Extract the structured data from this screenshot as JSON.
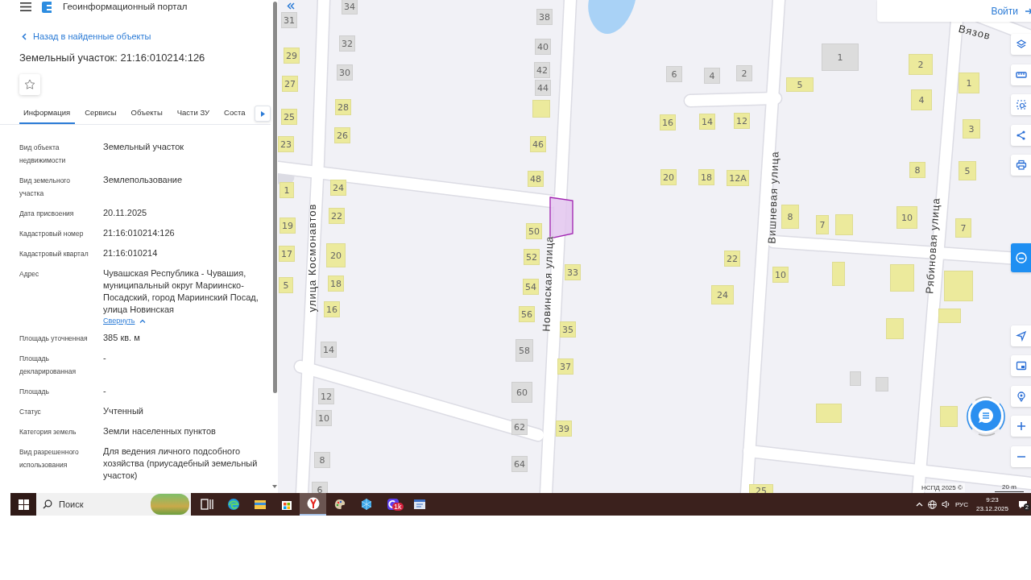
{
  "app_header": {
    "title": "Геоинформационный портал"
  },
  "back_link": "Назад в найденные объекты",
  "object_title": "Земельный участок: 21:16:010214:126",
  "favorite": {
    "on": false
  },
  "tabs": [
    {
      "label": "Информация",
      "selected": true
    },
    {
      "label": "Сервисы",
      "selected": false
    },
    {
      "label": "Объекты",
      "selected": false
    },
    {
      "label": "Части ЗУ",
      "selected": false
    },
    {
      "label": "Соста",
      "selected": false
    }
  ],
  "properties": [
    {
      "label": "Вид объекта недвижимости",
      "value": "Земельный участок"
    },
    {
      "label": "Вид земельного участка",
      "value": "Землепользование"
    },
    {
      "label": "Дата присвоения",
      "value": "20.11.2025"
    },
    {
      "label": "Кадастровый номер",
      "value": "21:16:010214:126"
    },
    {
      "label": "Кадастровый квартал",
      "value": "21:16:010214"
    },
    {
      "label": "Адрес",
      "value": "Чувашская Республика - Чувашия, муниципальный округ Мариинско-Посадский, город Мариинский Посад, улица Новинская",
      "link": "Свернуть"
    },
    {
      "label": "Площадь уточненная",
      "value": "385 кв. м"
    },
    {
      "label": "Площадь декларированная",
      "value": "-"
    },
    {
      "label": "Площадь",
      "value": "-"
    },
    {
      "label": "Статус",
      "value": "Учтенный"
    },
    {
      "label": "Категория земель",
      "value": "Земли населенных пунктов"
    },
    {
      "label": "Вид разрешенного использования",
      "value": "Для ведения личного подсобного хозяйства (приусадебный земельный участок)"
    }
  ],
  "map": {
    "buildings": [
      {
        "number": "31",
        "color": "#dcdcdc"
      },
      {
        "number": "29",
        "color": "#ecea9c"
      },
      {
        "number": "27",
        "color": "#ecea9c"
      },
      {
        "number": "25",
        "color": "#ecea9c"
      },
      {
        "number": "23",
        "color": "#ecea9c"
      },
      {
        "number": "1",
        "color": "#ecea9c"
      },
      {
        "number": "19",
        "color": "#ecea9c"
      },
      {
        "number": "17",
        "color": "#ecea9c"
      },
      {
        "number": "5",
        "color": "#ecea9c"
      },
      {
        "number": "34",
        "color": "#dcdcdc"
      },
      {
        "number": "32",
        "color": "#dcdcdc"
      },
      {
        "number": "30",
        "color": "#dcdcdc"
      },
      {
        "number": "28",
        "color": "#ecea9c"
      },
      {
        "number": "26",
        "color": "#ecea9c"
      },
      {
        "number": "24",
        "color": "#ecea9c"
      },
      {
        "number": "22",
        "color": "#ecea9c"
      },
      {
        "number": "20",
        "color": "#ecea9c"
      },
      {
        "number": "18",
        "color": "#ecea9c"
      },
      {
        "number": "16",
        "color": "#ecea9c"
      },
      {
        "number": "14",
        "color": "#dcdcdc"
      },
      {
        "number": "12",
        "color": "#dcdcdc"
      },
      {
        "number": "10",
        "color": "#dcdcdc"
      },
      {
        "number": "8",
        "color": "#dcdcdc"
      },
      {
        "number": "6",
        "color": "#dcdcdc"
      },
      {
        "number": "38",
        "color": "#dcdcdc"
      },
      {
        "number": "40",
        "color": "#dcdcdc"
      },
      {
        "number": "42",
        "color": "#dcdcdc"
      },
      {
        "number": "44",
        "color": "#dcdcdc"
      },
      {
        "number": "46",
        "color": "#ecea9c"
      },
      {
        "number": "48",
        "color": "#ecea9c"
      },
      {
        "number": "50",
        "color": "#ecea9c"
      },
      {
        "number": "52",
        "color": "#ecea9c"
      },
      {
        "number": "54",
        "color": "#ecea9c"
      },
      {
        "number": "56",
        "color": "#ecea9c"
      },
      {
        "number": "58",
        "color": "#dcdcdc"
      },
      {
        "number": "60",
        "color": "#dcdcdc"
      },
      {
        "number": "62",
        "color": "#dcdcdc"
      },
      {
        "number": "64",
        "color": "#dcdcdc"
      },
      {
        "number": "33",
        "color": "#ecea9c"
      },
      {
        "number": "35",
        "color": "#ecea9c"
      },
      {
        "number": "37",
        "color": "#ecea9c"
      },
      {
        "number": "39",
        "color": "#ecea9c"
      },
      {
        "number": "25",
        "color": "#ecea9c"
      },
      {
        "number": "6",
        "color": "#dcdcdc"
      },
      {
        "number": "4",
        "color": "#dcdcdc"
      },
      {
        "number": "2",
        "color": "#dcdcdc"
      },
      {
        "number": "1",
        "color": "#dcdcdc"
      },
      {
        "number": "2",
        "color": "#ecea9c"
      },
      {
        "number": "1",
        "color": "#ecea9c"
      },
      {
        "number": "4",
        "color": "#ecea9c"
      },
      {
        "number": "5",
        "color": "#ecea9c"
      },
      {
        "number": "16",
        "color": "#ecea9c"
      },
      {
        "number": "14",
        "color": "#ecea9c"
      },
      {
        "number": "12",
        "color": "#ecea9c"
      },
      {
        "number": "3",
        "color": "#ecea9c"
      },
      {
        "number": "8",
        "color": "#ecea9c"
      },
      {
        "number": "5",
        "color": "#ecea9c"
      },
      {
        "number": "20",
        "color": "#ecea9c"
      },
      {
        "number": "18",
        "color": "#ecea9c"
      },
      {
        "number": "12А",
        "color": "#ecea9c"
      },
      {
        "number": "8",
        "color": "#ecea9c"
      },
      {
        "number": "7",
        "color": "#ecea9c"
      },
      {
        "number": "10",
        "color": "#ecea9c"
      },
      {
        "number": "7",
        "color": "#ecea9c"
      },
      {
        "number": "22",
        "color": "#ecea9c"
      },
      {
        "number": "24",
        "color": "#ecea9c"
      },
      {
        "number": "10",
        "color": "#ecea9c"
      }
    ],
    "street_names": [
      "улица Космонавтов",
      "Новинская улица",
      "Вишневая улица",
      "Рябиновая улица",
      "Вязов"
    ],
    "attribution": "НСПД 2025 ©",
    "scale": "20 m"
  },
  "login": "Войти",
  "taskbar": {
    "search_placeholder": "Поиск",
    "apps": [
      {
        "kind": "taskview",
        "selected": false
      },
      {
        "kind": "edge",
        "selected": false
      },
      {
        "kind": "explorer",
        "selected": false
      },
      {
        "kind": "store",
        "selected": false
      },
      {
        "kind": "yandex",
        "selected": true
      },
      {
        "kind": "paint",
        "selected": false
      },
      {
        "kind": "cube",
        "selected": false
      },
      {
        "kind": "messenger",
        "selected": false,
        "badge": "1k"
      },
      {
        "kind": "editor",
        "selected": false
      }
    ],
    "language": "РУС",
    "time": "9:23",
    "date": "23.12.2025",
    "notifications": "2"
  }
}
